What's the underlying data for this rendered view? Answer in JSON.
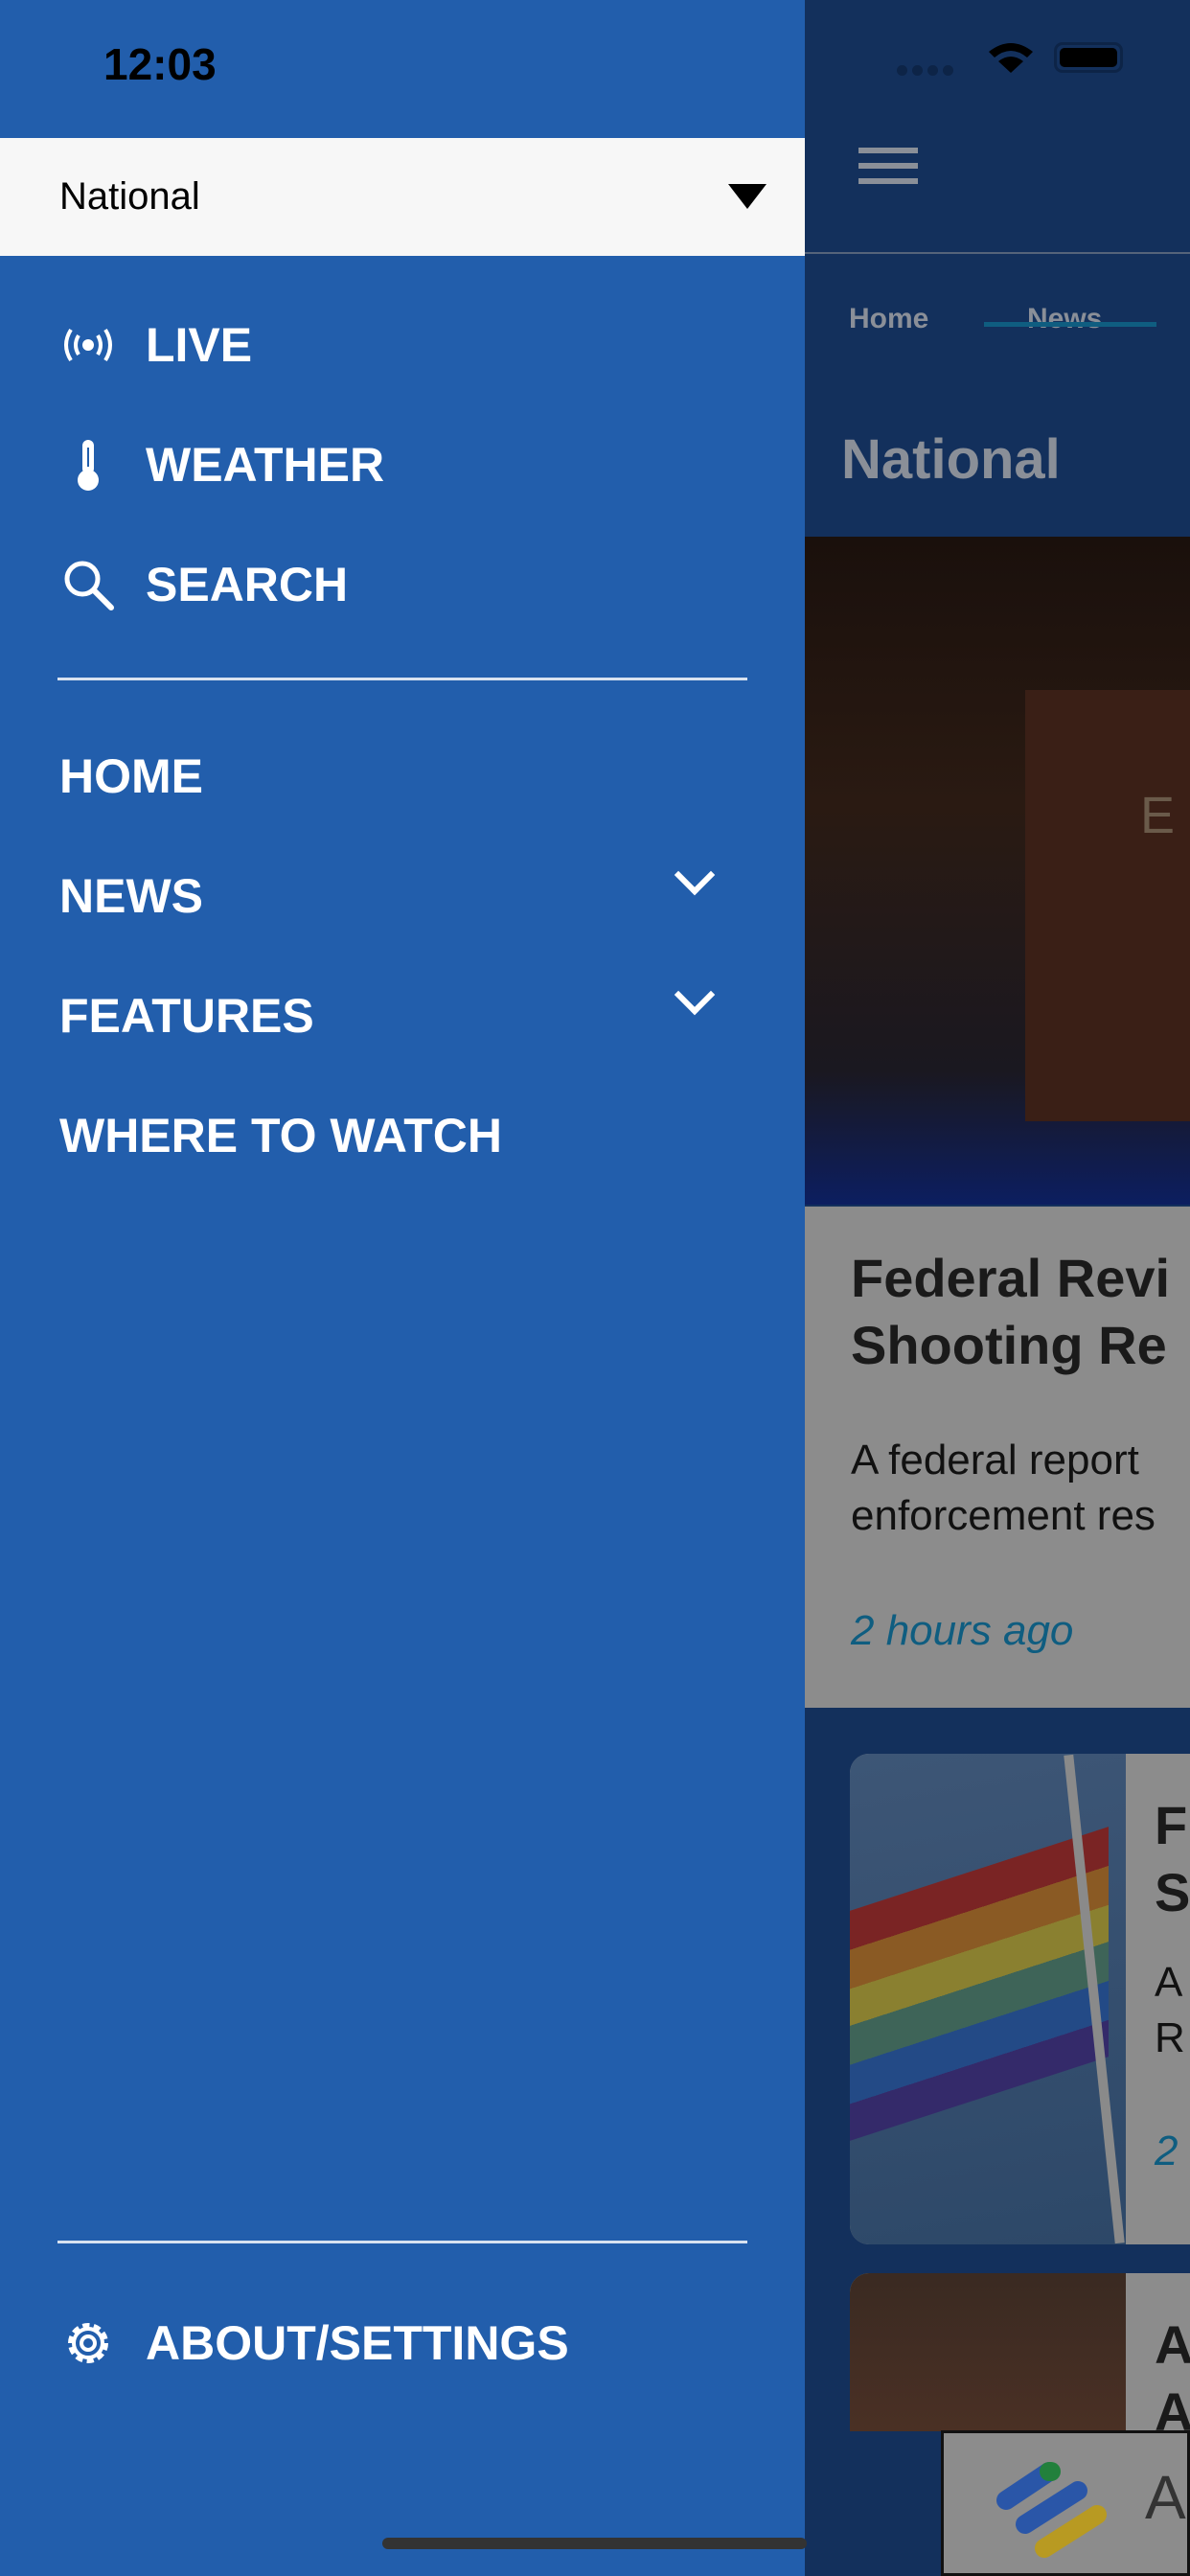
{
  "status_bar": {
    "time": "12:03"
  },
  "drawer": {
    "region_selector": {
      "value": "National"
    },
    "top_items": [
      {
        "label": "LIVE",
        "icon": "live-broadcast-icon"
      },
      {
        "label": "WEATHER",
        "icon": "thermometer-icon"
      },
      {
        "label": "SEARCH",
        "icon": "search-icon"
      }
    ],
    "nav_items": [
      {
        "label": "HOME"
      },
      {
        "label": "NEWS",
        "expandable": true
      },
      {
        "label": "FEATURES",
        "expandable": true
      },
      {
        "label": "WHERE TO WATCH"
      }
    ],
    "settings": {
      "label": "ABOUT/SETTINGS",
      "icon": "gear-icon"
    }
  },
  "main": {
    "tabs": [
      {
        "label": "Home"
      },
      {
        "label": "News",
        "active": true
      }
    ],
    "section_title": "National",
    "featured": {
      "title_line1": "Federal Revi",
      "title_line2": "Shooting Re",
      "desc_line1": "A federal report",
      "desc_line2": "enforcement res",
      "time": "2 hours ago"
    },
    "card2": {
      "title_line1": "F",
      "title_line2": "S",
      "desc_line1": "A",
      "desc_line2": "R",
      "time": "2"
    },
    "card3": {
      "title_line1": "A",
      "title_line2": "A"
    },
    "ad": {
      "text": "A"
    }
  },
  "colors": {
    "drawer": "#225eac",
    "accent": "#1a6f95",
    "overlay_bg": "#13305c"
  }
}
